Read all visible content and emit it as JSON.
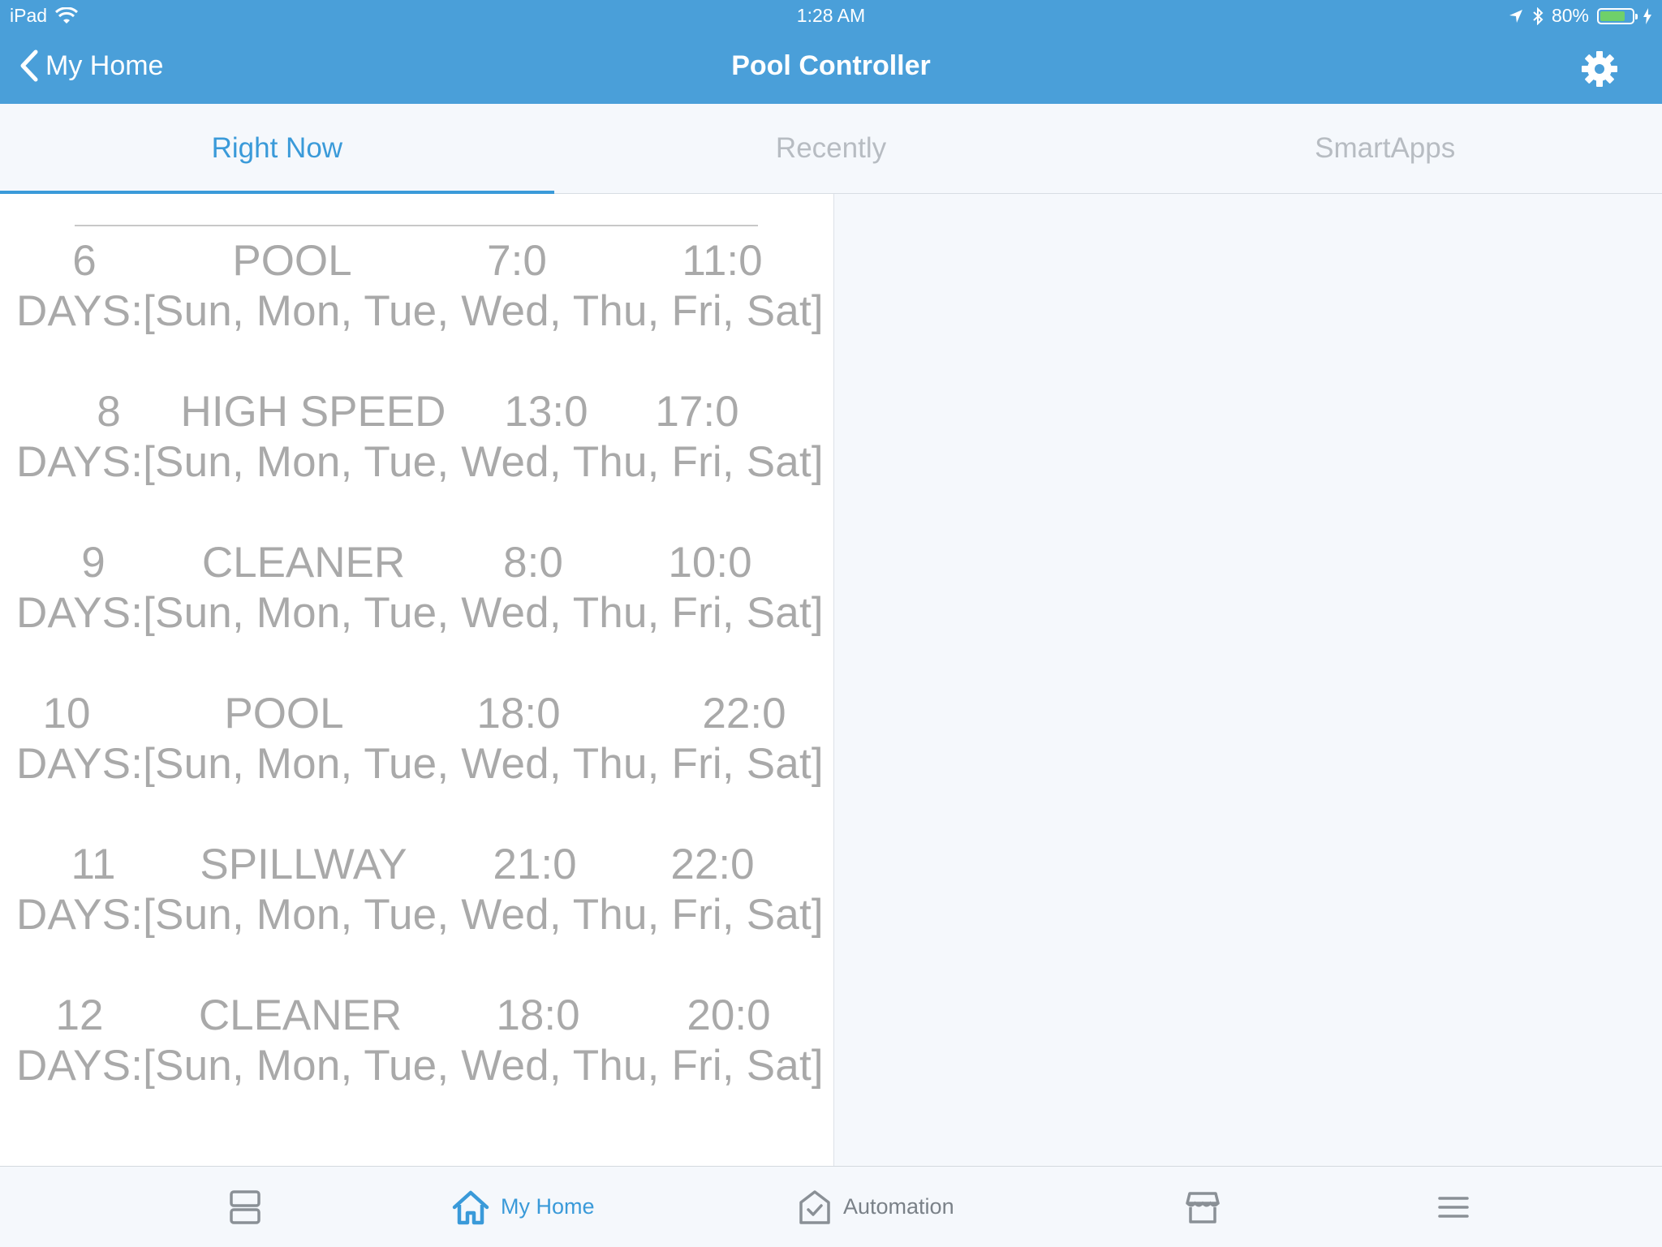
{
  "status_bar": {
    "device": "iPad",
    "time": "1:28 AM",
    "battery": "80%",
    "battery_level": 0.8
  },
  "header": {
    "back_label": "My Home",
    "title": "Pool Controller"
  },
  "tabs": [
    {
      "label": "Right Now",
      "active": true
    },
    {
      "label": "Recently",
      "active": false
    },
    {
      "label": "SmartApps",
      "active": false
    }
  ],
  "schedules": [
    {
      "id": "6",
      "circuit": "POOL",
      "start": "7:0",
      "end": "11:0",
      "days": "DAYS:[Sun, Mon, Tue, Wed, Thu, Fri, Sat]"
    },
    {
      "id": "8",
      "circuit": "HIGH SPEED",
      "start": "13:0",
      "end": "17:0",
      "days": "DAYS:[Sun, Mon, Tue, Wed, Thu, Fri, Sat]"
    },
    {
      "id": "9",
      "circuit": "CLEANER",
      "start": "8:0",
      "end": "10:0",
      "days": "DAYS:[Sun, Mon, Tue, Wed, Thu, Fri, Sat]"
    },
    {
      "id": "10",
      "circuit": "POOL",
      "start": "18:0",
      "end": "22:0",
      "days": "DAYS:[Sun, Mon, Tue, Wed, Thu, Fri, Sat]"
    },
    {
      "id": "11",
      "circuit": "SPILLWAY",
      "start": "21:0",
      "end": "22:0",
      "days": "DAYS:[Sun, Mon, Tue, Wed, Thu, Fri, Sat]"
    },
    {
      "id": "12",
      "circuit": "CLEANER",
      "start": "18:0",
      "end": "20:0",
      "days": "DAYS:[Sun, Mon, Tue, Wed, Thu, Fri, Sat]"
    }
  ],
  "bottom_nav": [
    {
      "icon": "dashboard-icon",
      "label": ""
    },
    {
      "icon": "home-icon",
      "label": "My Home",
      "active": true
    },
    {
      "icon": "automation-icon",
      "label": "Automation"
    },
    {
      "icon": "marketplace-icon",
      "label": ""
    },
    {
      "icon": "menu-icon",
      "label": ""
    }
  ],
  "colors": {
    "header": "#4a9fd9",
    "accent": "#3a9ad9",
    "schedule_text": "#a9a9a9"
  }
}
